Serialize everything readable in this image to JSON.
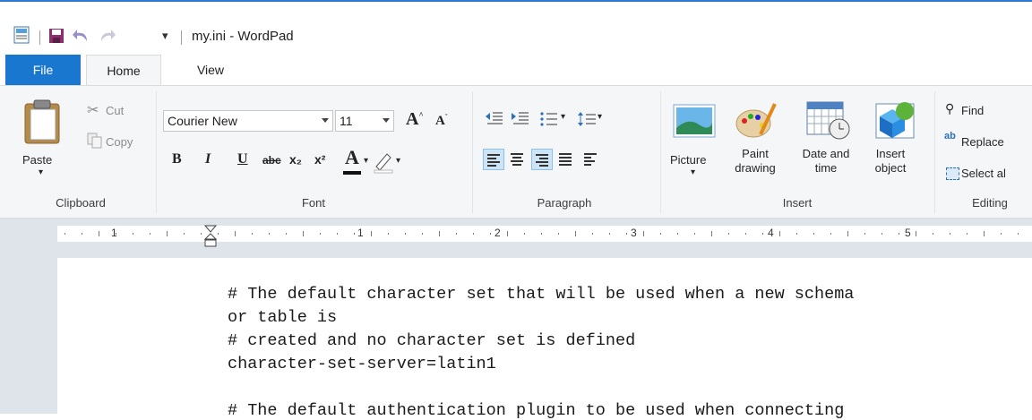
{
  "window": {
    "title": "my.ini - WordPad"
  },
  "tabs": {
    "file": "File",
    "home": "Home",
    "view": "View"
  },
  "clipboard": {
    "paste": "Paste",
    "cut": "Cut",
    "copy": "Copy",
    "group": "Clipboard"
  },
  "font": {
    "family": "Courier New",
    "size": "11",
    "group": "Font",
    "bold": "B",
    "italic": "I",
    "underline": "U",
    "strike": "abc",
    "subscript": "x₂",
    "superscript": "x²",
    "color_letter": "A"
  },
  "paragraph": {
    "group": "Paragraph"
  },
  "insert": {
    "group": "Insert",
    "picture": "Picture",
    "paint_line1": "Paint",
    "paint_line2": "drawing",
    "datetime_line1": "Date and",
    "datetime_line2": "time",
    "object_line1": "Insert",
    "object_line2": "object"
  },
  "editing": {
    "group": "Editing",
    "find": "Find",
    "replace": "Replace",
    "select_all": "Select al"
  },
  "ruler": {
    "labels": [
      "1",
      "1",
      "2",
      "3",
      "4",
      "5"
    ]
  },
  "document": {
    "lines": [
      "# The default character set that will be used when a new schema",
      "or table is",
      "# created and no character set is defined",
      "character-set-server=latin1",
      "",
      "# The default authentication plugin to be used when connecting"
    ]
  },
  "colors": {
    "accent": "#1977cf",
    "ribbon": "#f5f6f7",
    "workspace": "#dfe4ea"
  }
}
